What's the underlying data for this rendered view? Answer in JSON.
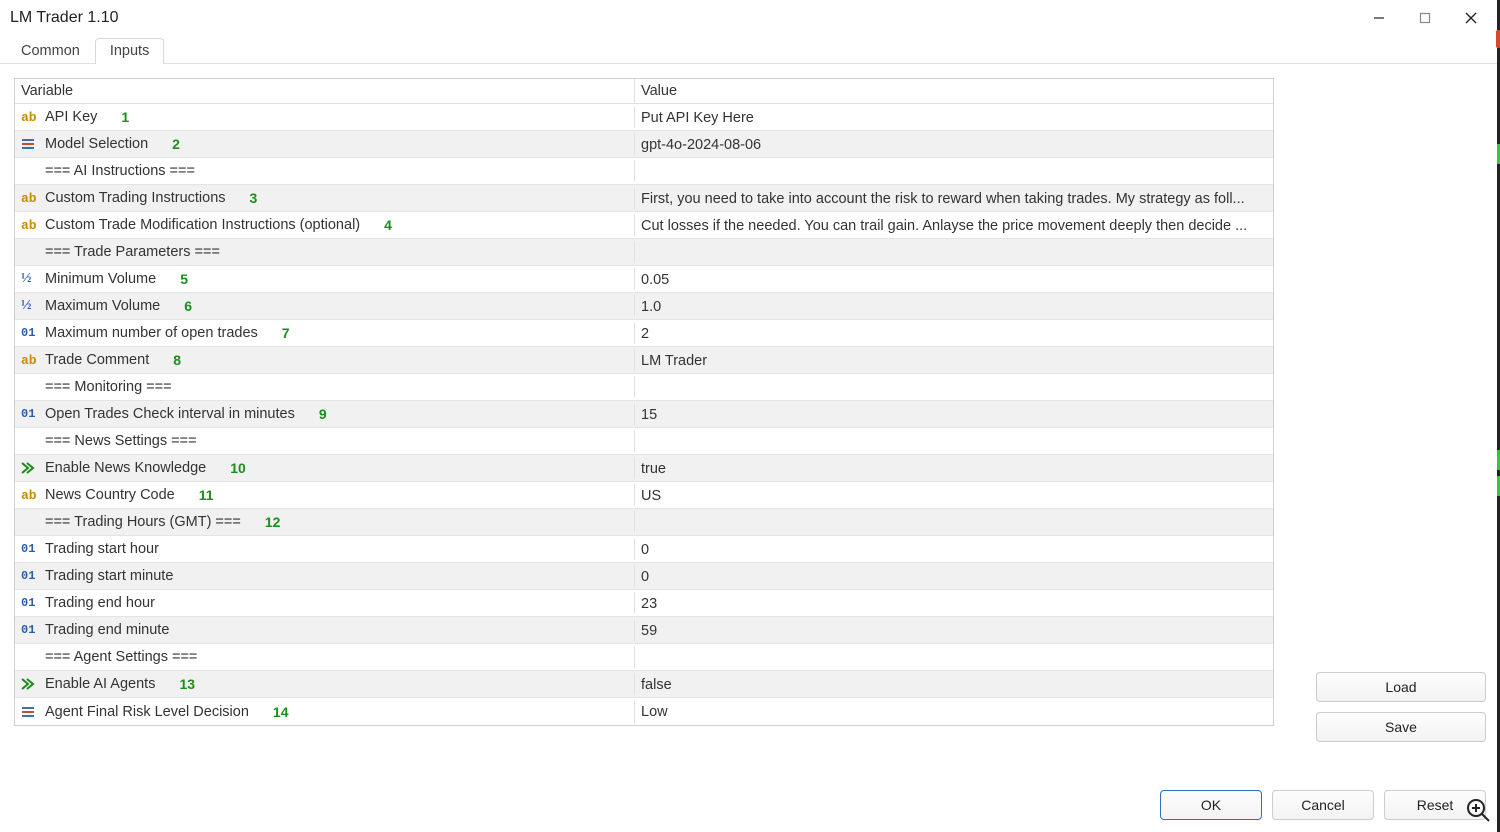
{
  "window": {
    "title": "LM Trader 1.10"
  },
  "tabs": {
    "common": "Common",
    "inputs": "Inputs"
  },
  "headers": {
    "variable": "Variable",
    "value": "Value"
  },
  "rows": [
    {
      "icon": "ab",
      "label": "API Key",
      "annot": "1",
      "value": "Put API Key Here",
      "alt": false
    },
    {
      "icon": "enum",
      "label": "Model Selection",
      "annot": "2",
      "value": "gpt-4o-2024-08-06",
      "alt": true
    },
    {
      "icon": "",
      "label": "=== AI Instructions ===",
      "annot": "",
      "value": "",
      "alt": false
    },
    {
      "icon": "ab",
      "label": "Custom Trading Instructions",
      "annot": "3",
      "value": "First, you need to take into account the risk to reward when taking trades. My strategy as foll...",
      "alt": true
    },
    {
      "icon": "ab",
      "label": "Custom Trade Modification Instructions (optional)",
      "annot": "4",
      "value": "Cut losses if the needed. You can trail gain. Anlayse the price movement deeply then decide ...",
      "alt": false
    },
    {
      "icon": "",
      "label": "=== Trade Parameters ===",
      "annot": "",
      "value": "",
      "alt": true
    },
    {
      "icon": "half",
      "label": "Minimum Volume",
      "annot": "5",
      "value": "0.05",
      "alt": false
    },
    {
      "icon": "half",
      "label": "Maximum Volume",
      "annot": "6",
      "value": "1.0",
      "alt": true
    },
    {
      "icon": "int",
      "label": "Maximum number of open trades",
      "annot": "7",
      "value": "2",
      "alt": false
    },
    {
      "icon": "ab",
      "label": "Trade Comment",
      "annot": "8",
      "value": "LM Trader",
      "alt": true
    },
    {
      "icon": "",
      "label": "=== Monitoring ===",
      "annot": "",
      "value": "",
      "alt": false
    },
    {
      "icon": "int",
      "label": "Open Trades Check interval in minutes",
      "annot": "9",
      "value": "15",
      "alt": true
    },
    {
      "icon": "",
      "label": "=== News Settings ===",
      "annot": "",
      "value": "",
      "alt": false
    },
    {
      "icon": "bool",
      "label": "Enable News Knowledge",
      "annot": "10",
      "value": "true",
      "alt": true
    },
    {
      "icon": "ab",
      "label": "News Country Code",
      "annot": "11",
      "value": "US",
      "alt": false
    },
    {
      "icon": "",
      "label": "=== Trading Hours (GMT) ===",
      "annot": "12",
      "value": "",
      "alt": true
    },
    {
      "icon": "int",
      "label": "Trading start hour",
      "annot": "",
      "value": "0",
      "alt": false
    },
    {
      "icon": "int",
      "label": "Trading start minute",
      "annot": "",
      "value": "0",
      "alt": true
    },
    {
      "icon": "int",
      "label": "Trading end hour",
      "annot": "",
      "value": "23",
      "alt": false
    },
    {
      "icon": "int",
      "label": "Trading end minute",
      "annot": "",
      "value": "59",
      "alt": true
    },
    {
      "icon": "",
      "label": "=== Agent Settings ===",
      "annot": "",
      "value": "",
      "alt": false
    },
    {
      "icon": "bool",
      "label": "Enable AI Agents",
      "annot": "13",
      "value": "false",
      "alt": true
    },
    {
      "icon": "enum",
      "label": "Agent Final Risk Level Decision",
      "annot": "14",
      "value": "Low",
      "alt": false
    }
  ],
  "buttons": {
    "load": "Load",
    "save": "Save",
    "ok": "OK",
    "cancel": "Cancel",
    "reset": "Reset"
  }
}
